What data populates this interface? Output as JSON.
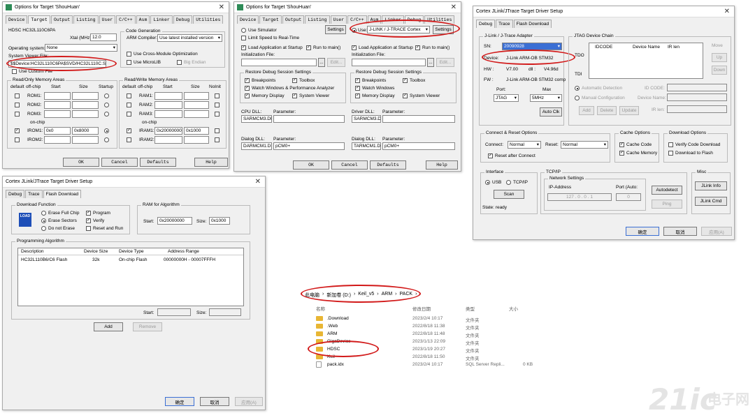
{
  "w1": {
    "title": "Options for Target 'ShouHuan'",
    "tabs": [
      "Device",
      "Target",
      "Output",
      "Listing",
      "User",
      "C/C++",
      "Asm",
      "Linker",
      "Debug",
      "Utilities"
    ],
    "device_name": "HDSC HC32L110C6PA",
    "xtal_label": "Xtal (MHz):",
    "xtal_value": "12.0",
    "os_label": "Operating system:",
    "os_value": "None",
    "svf_label": "System Viewer File:",
    "svf_value": "$$Device:HC32L110C6PA$SVD/HC32L110C.SFR",
    "custom_file": "Use Custom File",
    "codegen_title": "Code Generation",
    "arm_compiler_label": "ARM Compiler:",
    "arm_compiler_value": "Use latest installed version",
    "cross_module": "Use Cross-Module Optimization",
    "microlib": "Use MicroLIB",
    "big_endian": "Big Endian",
    "rom_title": "Read/Only Memory Areas",
    "ram_title": "Read/Write Memory Areas",
    "col_default": "default",
    "col_offchip": "off-chip",
    "col_start": "Start",
    "col_size": "Size",
    "col_startup": "Startup",
    "col_noinit": "NoInit",
    "rom_rows": [
      "ROM1:",
      "ROM2:",
      "ROM3:"
    ],
    "onchip": "on-chip",
    "irom1": "IROM1:",
    "irom1_start": "0x0",
    "irom1_size": "0x8000",
    "irom2": "IROM2:",
    "ram_rows": [
      "RAM1:",
      "RAM2:",
      "RAM3:"
    ],
    "iram1": "IRAM1:",
    "iram1_start": "0x20000000",
    "iram1_size": "0x1000",
    "iram2": "IRAM2:",
    "ok": "OK",
    "cancel": "Cancel",
    "defaults": "Defaults",
    "help": "Help"
  },
  "w2": {
    "title": "Options for Target 'ShouHuan'",
    "tabs": [
      "Device",
      "Target",
      "Output",
      "Listing",
      "User",
      "C/C++",
      "Asm",
      "Linker",
      "Debug",
      "Utilities"
    ],
    "use_sim": "Use Simulator",
    "limit_speed": "Limit Speed to Real-Time",
    "settings": "Settings",
    "use_label": "Use:",
    "use_value": "J-LINK / J-TRACE Cortex",
    "load_app": "Load Application at Startup",
    "run_main": "Run to main()",
    "init_file": "Initialization File:",
    "edit": "Edit...",
    "dots": "...",
    "restore_title": "Restore Debug Session Settings",
    "breakpoints": "Breakpoints",
    "toolbox": "Toolbox",
    "watch_windows_perf": "Watch Windows & Performance Analyzer",
    "watch_windows": "Watch Windows",
    "memory_display": "Memory Display",
    "system_viewer": "System Viewer",
    "cpu_dll": "CPU DLL:",
    "driver_dll": "Driver DLL:",
    "parameter": "Parameter:",
    "cpu_dll_value": "SARMCM3.DLL",
    "driver_dll_value": "SARMCM3.DLL",
    "dialog_dll": "Dialog DLL:",
    "dialog_dll_left": "DARMCM1.DLL",
    "dialog_param_left": "pCM0+",
    "dialog_dll_right": "TARMCM1.DLL",
    "dialog_param_right": "pCM0+",
    "ok": "OK",
    "cancel": "Cancel",
    "defaults": "Defaults",
    "help": "Help"
  },
  "w3": {
    "title": "Cortex JLink/JTrace Target Driver Setup",
    "tabs": [
      "Debug",
      "Trace",
      "Flash Download"
    ],
    "adapter_title": "J-Link / J-Trace Adapter",
    "sn_label": "SN:",
    "sn_value": "20090928",
    "device_label": "Device:",
    "device_value": "J-Link ARM-OB STM32",
    "hw_label": "HW :",
    "hw_value": "V7.00",
    "dll_label": "dll :",
    "dll_value": "V4.96d",
    "fw_label": "FW :",
    "fw_value": "J-Link ARM-OB STM32 comp",
    "port_label": "Port:",
    "port_value": "JTAG",
    "max_label": "Max",
    "max_value": "5MHz",
    "auto_clk": "Auto Clk",
    "jtag_title": "JTAG Device Chain",
    "tdo": "TDO",
    "tdi": "TDI",
    "col_idcode": "IDCODE",
    "col_devname": "Device Name",
    "col_irlen": "IR len",
    "move": "Move",
    "up": "Up",
    "down": "Down",
    "auto_detect": "Automatic Detection",
    "manual_config": "Manual Configuration",
    "id_code": "ID CODE:",
    "device_name": "Device Name:",
    "ir_len": "IR len:",
    "add": "Add",
    "delete": "Delete",
    "update": "Update",
    "connect_title": "Connect & Reset Options",
    "connect_label": "Connect:",
    "connect_value": "Normal",
    "reset_label": "Reset:",
    "reset_value": "Normal",
    "reset_after": "Reset after Connect",
    "cache_title": "Cache Options",
    "cache_code": "Cache Code",
    "cache_memory": "Cache Memory",
    "download_title": "Download Options",
    "verify_code": "Verify Code Download",
    "download_flash": "Download to Flash",
    "interface_title": "Interface",
    "usb": "USB",
    "tcpip": "TCP/IP",
    "scan": "Scan",
    "state": "State: ready",
    "tcp_title": "TCP/IP",
    "net_settings": "Network Settings",
    "ip_label": "IP-Address",
    "ip_value": "127 . 0 . 0 . 1",
    "port_auto": "Port (Auto:",
    "port_num": "0",
    "autodetect": "Autodetect",
    "ping": "Ping",
    "misc_title": "Misc",
    "jlink_info": "JLink Info",
    "jlink_cmd": "JLink Cmd",
    "ok": "确定",
    "cancel": "取消",
    "apply": "应用(A)"
  },
  "w4": {
    "title": "Cortex JLink/JTrace Target Driver Setup",
    "tabs": [
      "Debug",
      "Trace",
      "Flash Download"
    ],
    "dl_title": "Download Function",
    "load_icon_text": "LOAD",
    "erase_full": "Erase Full Chip",
    "erase_sectors": "Erase Sectors",
    "do_not_erase": "Do not Erase",
    "program": "Program",
    "verify": "Verify",
    "reset_run": "Reset and Run",
    "ram_title": "RAM for Algorithm",
    "start_label": "Start:",
    "start_value": "0x20000000",
    "size_label": "Size:",
    "size_value": "0x1000",
    "prog_title": "Programming Algorithm",
    "col_desc": "Description",
    "col_size": "Device Size",
    "col_type": "Device Type",
    "col_range": "Address Range",
    "row": {
      "desc": "HC32L110B6/C6 Flash",
      "size": "32k",
      "type": "On-chip Flash",
      "range": "00000000H - 00007FFFH"
    },
    "start2": "Start:",
    "size2": "Size:",
    "add": "Add",
    "remove": "Remove",
    "ok": "确定",
    "cancel": "取消",
    "apply": "应用(A)"
  },
  "explorer": {
    "breadcrumb": [
      "此电脑",
      "新加卷 (D:)",
      "Keil_v5",
      "ARM",
      "PACK"
    ],
    "col_name": "名称",
    "col_date": "修改日期",
    "col_type": "类型",
    "col_size": "大小",
    "rows": [
      {
        "name": ".Download",
        "date": "2023/2/4 10:17",
        "type": "文件夹",
        "size": ""
      },
      {
        "name": ".Web",
        "date": "2022/8/18 11:38",
        "type": "文件夹",
        "size": ""
      },
      {
        "name": "ARM",
        "date": "2022/8/18 11:48",
        "type": "文件夹",
        "size": ""
      },
      {
        "name": "GigaDevice",
        "date": "2023/1/13 22:09",
        "type": "文件夹",
        "size": ""
      },
      {
        "name": "HDSC",
        "date": "2023/1/19 20:27",
        "type": "文件夹",
        "size": ""
      },
      {
        "name": "Keil",
        "date": "2022/8/18 11:50",
        "type": "文件夹",
        "size": ""
      },
      {
        "name": "pack.idx",
        "date": "2023/2/4 10:17",
        "type": "SQL Server Repli...",
        "size": "0 KB"
      }
    ]
  },
  "watermark": {
    "text": "21ic",
    "sub": "电子网"
  }
}
